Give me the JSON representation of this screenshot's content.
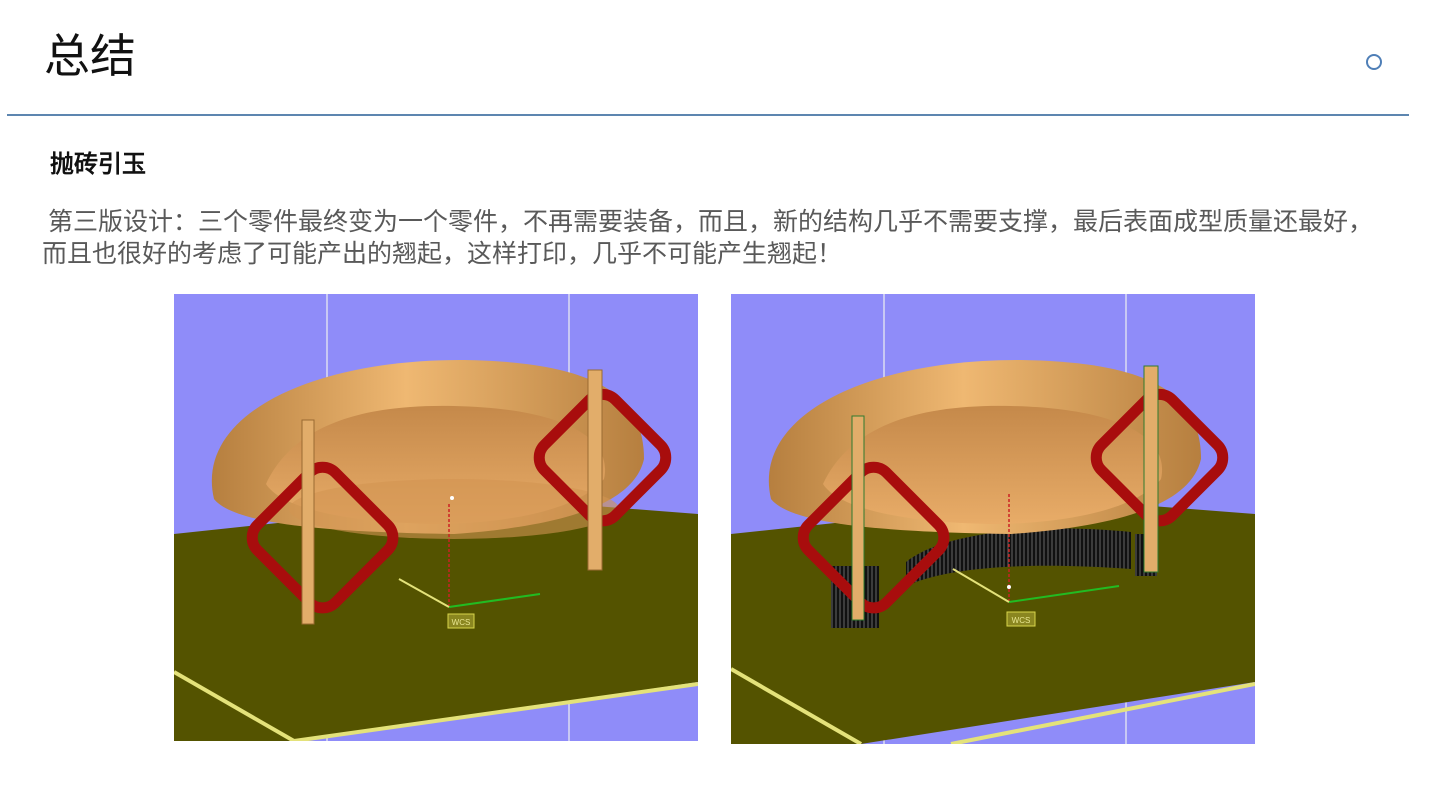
{
  "slide": {
    "title": "总结",
    "subheading": "抛砖引玉",
    "body": "第三版设计：三个零件最终变为一个零件，不再需要装备，而且，新的结构几乎不需要支撑，最后表面成型质量还最好，而且也很好的考虑了可能产出的翘起，这样打印，几乎不可能产生翘起！"
  },
  "figures": [
    {
      "id": "left",
      "axis_label": "WCS",
      "supports_visible": false
    },
    {
      "id": "right",
      "axis_label": "WCS",
      "supports_visible": true
    }
  ],
  "colors": {
    "background_sky": "#8f8cf9",
    "platform": "#545300",
    "platform_edge": "#e4e27a",
    "part_body": "#d9a25d",
    "part_shadow": "#b67f3f",
    "frame_red": "#a80d0d",
    "divider": "#5d86b0",
    "accent_circle": "#4f7fb7"
  },
  "icons": {
    "header_right": "circle-outline-icon"
  }
}
